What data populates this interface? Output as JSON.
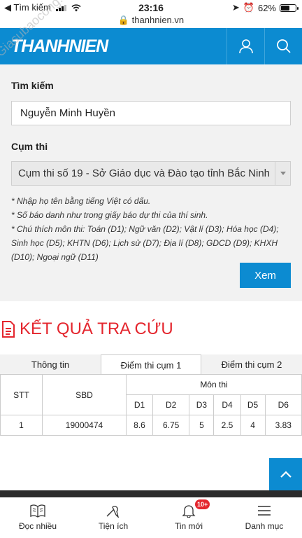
{
  "status_bar": {
    "back_app": "Tìm kiếm",
    "time": "23:16",
    "url": "thanhnien.vn",
    "battery": "62%",
    "battery_level": 0.62
  },
  "header": {
    "logo": "THANHNIEN"
  },
  "search_form": {
    "name_label": "Tìm kiếm",
    "name_value": "Nguyễn Minh Huyền",
    "cluster_label": "Cụm thi",
    "cluster_value": "Cụm thi số 19 - Sở Giáo dục và Đào tạo tỉnh Bắc Ninh",
    "notes": [
      "* Nhập họ tên bằng tiếng Việt có dấu.",
      "* Số báo danh như trong giấy báo dự thi của thí sinh.",
      "* Chú thích môn thi: Toán (D1); Ngữ văn (D2); Vật lí (D3); Hóa học (D4); Sinh học (D5); KHTN (D6); Lịch sử (D7); Địa lí (D8); GDCD (D9); KHXH (D10); Ngoại ngữ (D11)"
    ],
    "submit_label": "Xem"
  },
  "results": {
    "title": "KẾT QUẢ TRA CỨU",
    "tabs": [
      "Thông tin",
      "Điểm thi cụm 1",
      "Điểm thi cụm 2"
    ],
    "active_tab": 1,
    "headers": {
      "stt": "STT",
      "sbd": "SBD",
      "subjects": "Môn thi",
      "subject_codes": [
        "D1",
        "D2",
        "D3",
        "D4",
        "D5",
        "D6"
      ]
    },
    "rows": [
      {
        "stt": "1",
        "sbd": "19000474",
        "scores": [
          "8.6",
          "6.75",
          "5",
          "2.5",
          "4",
          "3.83"
        ]
      }
    ]
  },
  "bottom_nav": [
    {
      "label": "Đọc nhiều",
      "icon": "book-icon"
    },
    {
      "label": "Tiện ích",
      "icon": "tools-icon"
    },
    {
      "label": "Tin mới",
      "icon": "bell-icon",
      "badge": "10+"
    },
    {
      "label": "Danh mục",
      "icon": "menu-icon"
    }
  ],
  "watermark": "Giasubaocong.net",
  "colors": {
    "brand_blue": "#0c8bd1",
    "accent_red": "#e4262e",
    "form_bg": "#f2f2f2"
  }
}
